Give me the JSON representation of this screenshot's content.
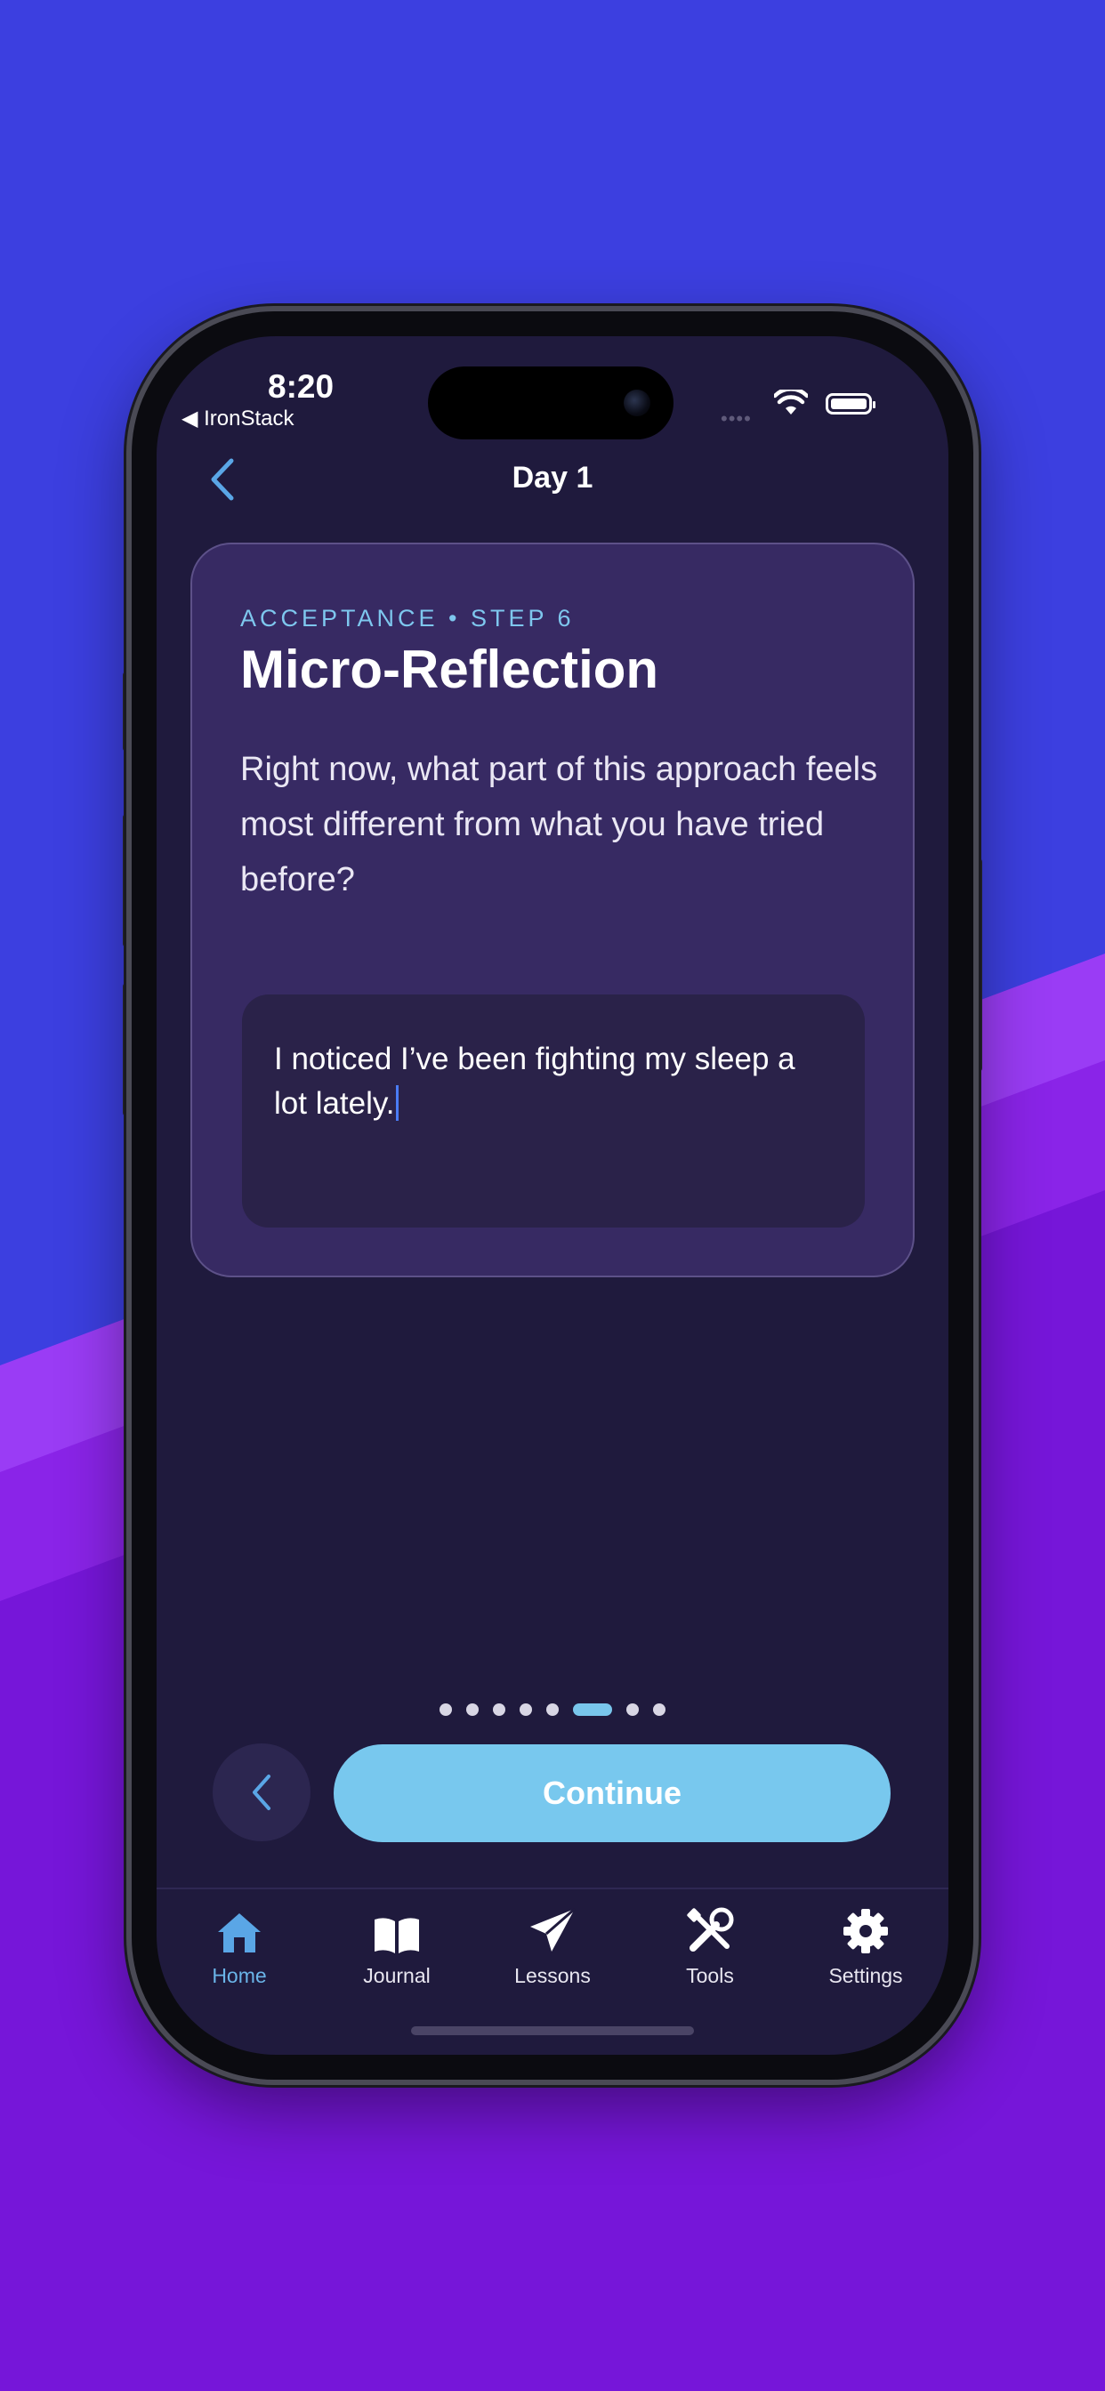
{
  "status_bar": {
    "time": "8:20",
    "back_app": "◀ IronStack",
    "signal": "••••"
  },
  "nav": {
    "title": "Day 1"
  },
  "card": {
    "eyebrow": "ACCEPTANCE • STEP 6",
    "title": "Micro-Reflection",
    "prompt": "Right now, what part of this approach feels most different from what you have tried before?",
    "answer_value": "I noticed I’ve been fighting my sleep a lot lately."
  },
  "pager": {
    "total_steps": 8,
    "current_step": 6
  },
  "actions": {
    "continue_label": "Continue"
  },
  "tabs": [
    {
      "label": "Home",
      "icon": "house-icon",
      "active": true
    },
    {
      "label": "Journal",
      "icon": "book-icon",
      "active": false
    },
    {
      "label": "Lessons",
      "icon": "paper-plane-icon",
      "active": false
    },
    {
      "label": "Tools",
      "icon": "tools-icon",
      "active": false
    },
    {
      "label": "Settings",
      "icon": "gear-icon",
      "active": false
    }
  ],
  "colors": {
    "background": "#3c3fe0",
    "stripe_light": "#9a3cf5",
    "stripe_dark": "#7616d9",
    "screen": "#1f1a3d",
    "card": "#372a63",
    "accent": "#78c8ee",
    "active_tab": "#6ab4e8"
  }
}
